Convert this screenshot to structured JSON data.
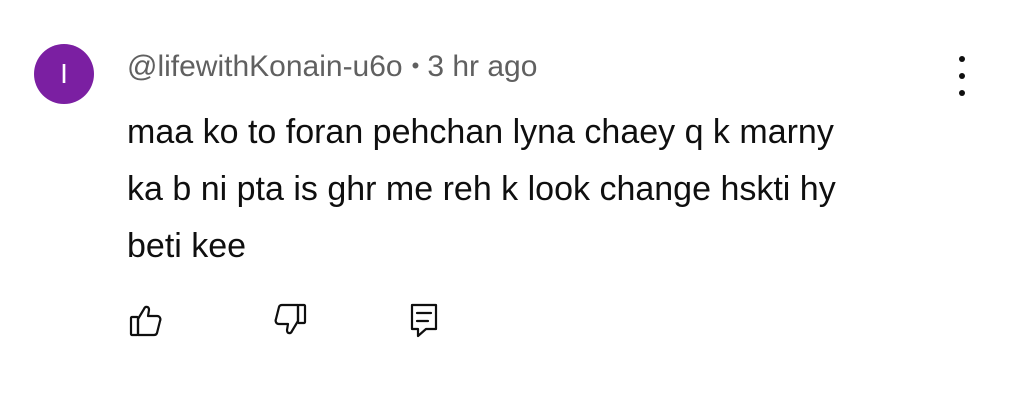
{
  "comment": {
    "avatar_letter": "I",
    "avatar_color": "#7b1fa2",
    "author": "@lifewithKonain-u6o",
    "separator": "•",
    "time": "3 hr ago",
    "lines": [
      "maa ko to foran pehchan lyna chaey q k marny",
      "ka b ni pta is ghr me reh k look change hskti hy",
      "beti kee"
    ]
  },
  "actions": {
    "like_icon": "thumbs-up-icon",
    "dislike_icon": "thumbs-down-icon",
    "reply_icon": "reply-comment-icon",
    "menu_icon": "more-vertical-icon"
  }
}
